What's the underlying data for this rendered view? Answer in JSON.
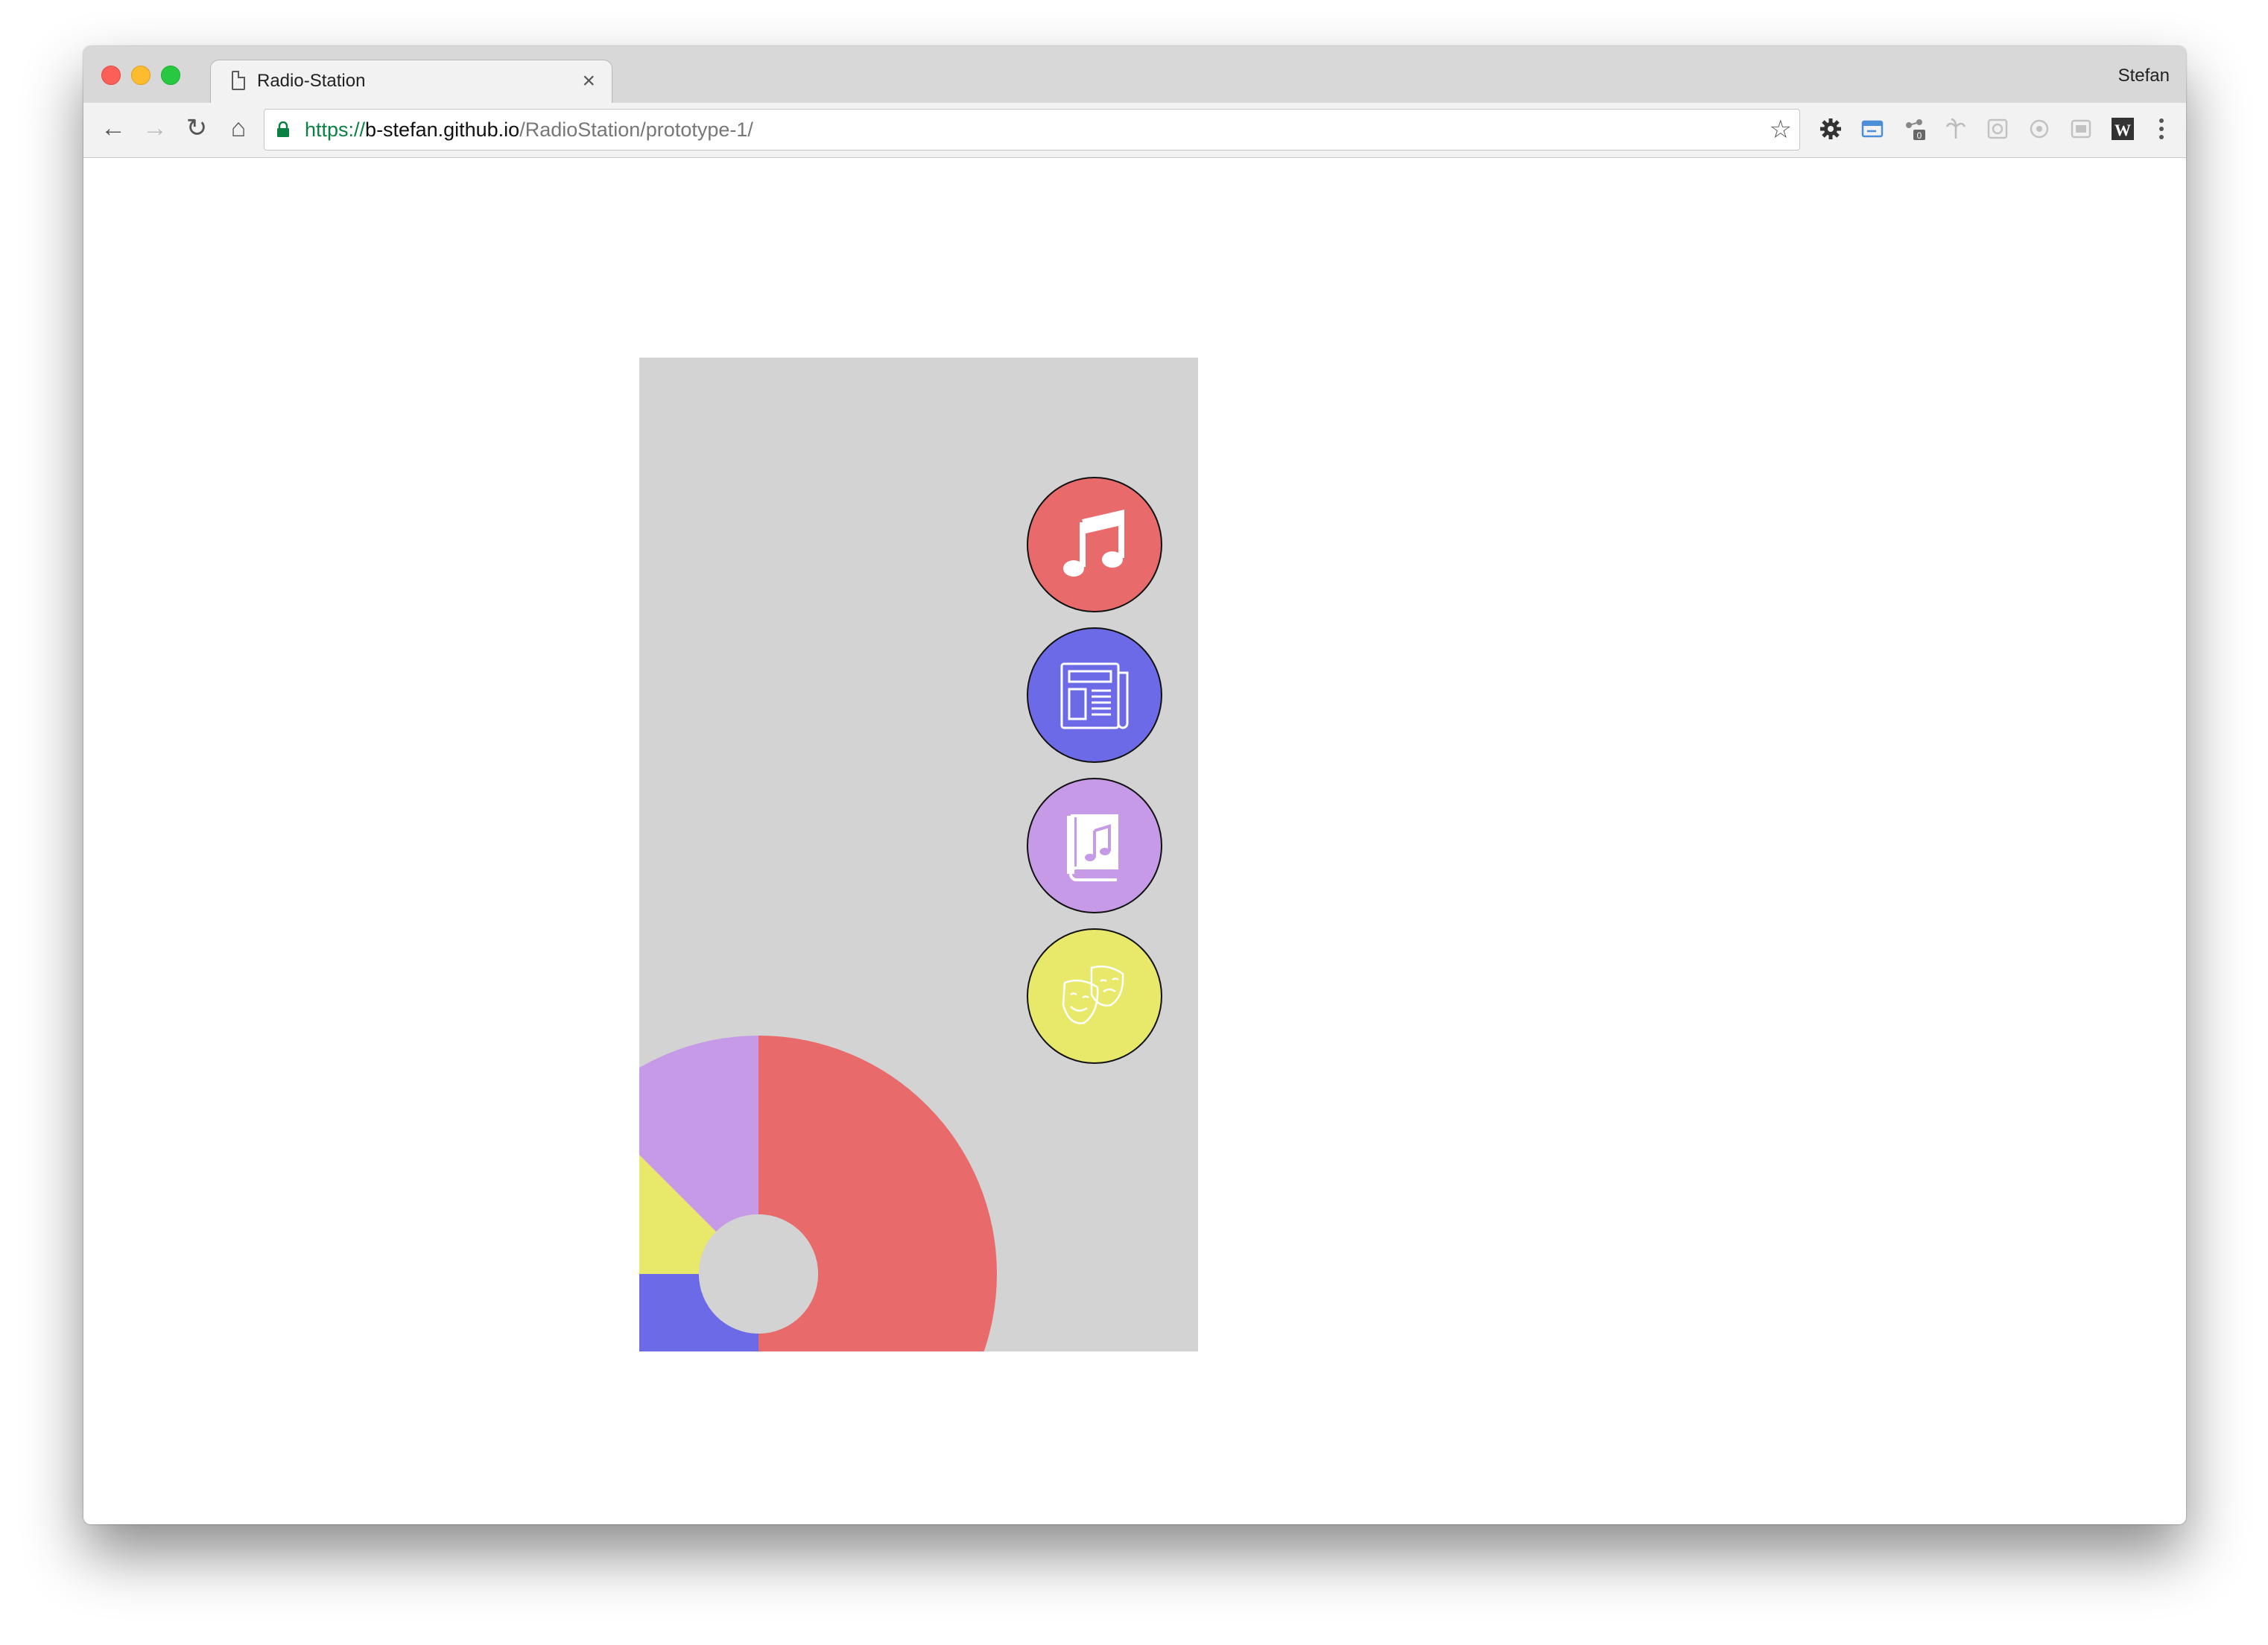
{
  "browser": {
    "tab_title": "Radio-Station",
    "tab_close": "×",
    "profile_name": "Stefan",
    "url_scheme": "https://",
    "url_host": "b-stefan.github.io",
    "url_path": "/RadioStation/prototype-1/"
  },
  "toolbar": {
    "back": "←",
    "forward": "→",
    "reload": "↻",
    "home": "⌂",
    "star": "☆"
  },
  "colors": {
    "music": "#e96a6a",
    "news": "#6c6ae6",
    "audiobooks": "#c69ae6",
    "theater": "#e8e86a",
    "screen_bg": "#d3d3d3"
  },
  "categories": [
    {
      "id": "music",
      "icon": "music-note-icon"
    },
    {
      "id": "news",
      "icon": "newspaper-icon"
    },
    {
      "id": "audiobooks",
      "icon": "music-book-icon"
    },
    {
      "id": "theater",
      "icon": "theater-masks-icon"
    }
  ],
  "wheel_segments": [
    {
      "category": "music",
      "color": "#e96a6a"
    },
    {
      "category": "audiobooks",
      "color": "#c69ae6"
    },
    {
      "category": "theater",
      "color": "#e8e86a"
    },
    {
      "category": "news",
      "color": "#6c6ae6"
    }
  ]
}
